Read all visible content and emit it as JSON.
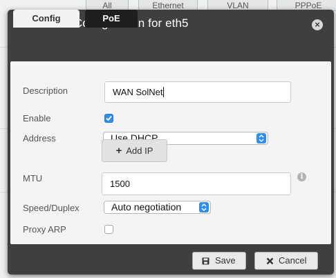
{
  "background": {
    "tabs": [
      "All",
      "Ethernet",
      "VLAN",
      "PPPoE"
    ]
  },
  "dialog": {
    "title": "Interface Configuration for eth5",
    "close_symbol": "×"
  },
  "tabs": [
    {
      "label": "Config",
      "active": true
    },
    {
      "label": "PoE",
      "active": false
    }
  ],
  "form": {
    "description": {
      "label": "Description",
      "value": "WAN SolNet"
    },
    "enable": {
      "label": "Enable",
      "checked": true
    },
    "address": {
      "label": "Address",
      "selected": "Use DHCP"
    },
    "add_ip": {
      "icon": "+",
      "label": "Add IP"
    },
    "mtu": {
      "label": "MTU",
      "value": "1500",
      "info_icon": "i"
    },
    "speed_duplex": {
      "label": "Speed/Duplex",
      "selected": "Auto negotiation"
    },
    "proxy_arp": {
      "label": "Proxy ARP",
      "checked": false
    }
  },
  "footer": {
    "save_label": "Save",
    "cancel_label": "Cancel"
  },
  "colors": {
    "dialog_bg": "#3f3f3f",
    "panel_bg": "#f4f4f4",
    "accent": "#2e8ef0"
  }
}
